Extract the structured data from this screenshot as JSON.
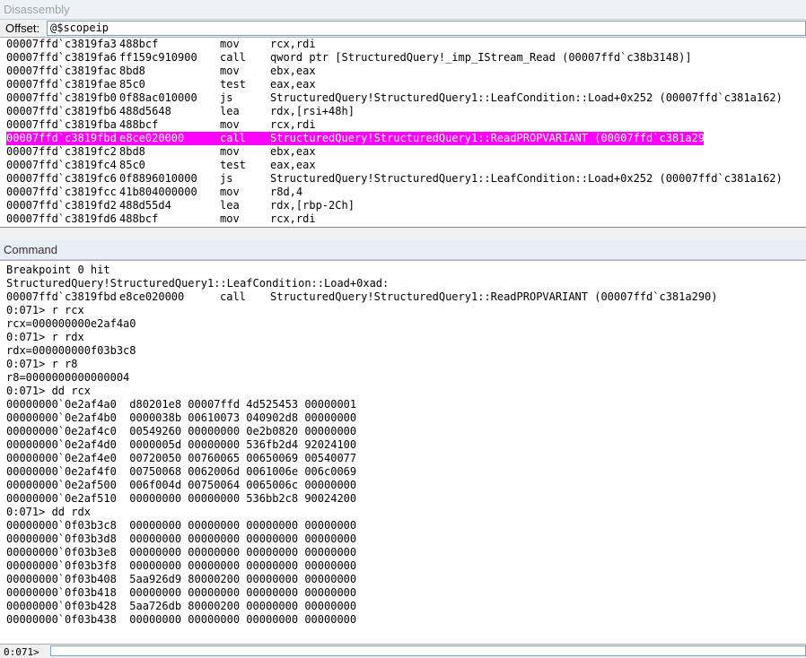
{
  "disassembly": {
    "title": "Disassembly",
    "offset_label": "Offset:",
    "offset_value": "@$scopeip",
    "rows": [
      {
        "addr": "00007ffd`c3819fa3",
        "bytes": "488bcf",
        "mnemonic": "mov",
        "operands": "rcx,rdi"
      },
      {
        "addr": "00007ffd`c3819fa6",
        "bytes": "ff159c910900",
        "mnemonic": "call",
        "operands": "qword ptr [StructuredQuery!_imp_IStream_Read (00007ffd`c38b3148)]"
      },
      {
        "addr": "00007ffd`c3819fac",
        "bytes": "8bd8",
        "mnemonic": "mov",
        "operands": "ebx,eax"
      },
      {
        "addr": "00007ffd`c3819fae",
        "bytes": "85c0",
        "mnemonic": "test",
        "operands": "eax,eax"
      },
      {
        "addr": "00007ffd`c3819fb0",
        "bytes": "0f88ac010000",
        "mnemonic": "js",
        "operands": "StructuredQuery!StructuredQuery1::LeafCondition::Load+0x252 (00007ffd`c381a162)"
      },
      {
        "addr": "00007ffd`c3819fb6",
        "bytes": "488d5648",
        "mnemonic": "lea",
        "operands": "rdx,[rsi+48h]"
      },
      {
        "addr": "00007ffd`c3819fba",
        "bytes": "488bcf",
        "mnemonic": "mov",
        "operands": "rcx,rdi"
      },
      {
        "addr": "00007ffd`c3819fbd",
        "bytes": "e8ce020000",
        "mnemonic": "call",
        "operands": "StructuredQuery!StructuredQuery1::ReadPROPVARIANT (00007ffd`c381a290)",
        "highlighted": true
      },
      {
        "addr": "00007ffd`c3819fc2",
        "bytes": "8bd8",
        "mnemonic": "mov",
        "operands": "ebx,eax"
      },
      {
        "addr": "00007ffd`c3819fc4",
        "bytes": "85c0",
        "mnemonic": "test",
        "operands": "eax,eax"
      },
      {
        "addr": "00007ffd`c3819fc6",
        "bytes": "0f8896010000",
        "mnemonic": "js",
        "operands": "StructuredQuery!StructuredQuery1::LeafCondition::Load+0x252 (00007ffd`c381a162)"
      },
      {
        "addr": "00007ffd`c3819fcc",
        "bytes": "41b804000000",
        "mnemonic": "mov",
        "operands": "r8d,4"
      },
      {
        "addr": "00007ffd`c3819fd2",
        "bytes": "488d55d4",
        "mnemonic": "lea",
        "operands": "rdx,[rbp-2Ch]"
      },
      {
        "addr": "00007ffd`c3819fd6",
        "bytes": "488bcf",
        "mnemonic": "mov",
        "operands": "rcx,rdi"
      }
    ],
    "highlight_color": "#ff00ff"
  },
  "command": {
    "title": "Command",
    "prompt_label": "0:071>",
    "lines": [
      "Breakpoint 0 hit",
      "StructuredQuery!StructuredQuery1::LeafCondition::Load+0xad:",
      {
        "addr": "00007ffd`c3819fbd",
        "bytes": "e8ce020000",
        "mnemonic": "call",
        "operands": "StructuredQuery!StructuredQuery1::ReadPROPVARIANT (00007ffd`c381a290)"
      },
      "0:071> r rcx",
      "rcx=000000000e2af4a0",
      "0:071> r rdx",
      "rdx=000000000f03b3c8",
      "0:071> r r8",
      "r8=0000000000000004",
      "0:071> dd rcx",
      "00000000`0e2af4a0  d80201e8 00007ffd 4d525453 00000001",
      "00000000`0e2af4b0  0000038b 00610073 040902d8 00000000",
      "00000000`0e2af4c0  00549260 00000000 0e2b0820 00000000",
      "00000000`0e2af4d0  0000005d 00000000 536fb2d4 92024100",
      "00000000`0e2af4e0  00720050 00760065 00650069 00540077",
      "00000000`0e2af4f0  00750068 0062006d 0061006e 006c0069",
      "00000000`0e2af500  006f004d 00750064 0065006c 00000000",
      "00000000`0e2af510  00000000 00000000 536bb2c8 90024200",
      "0:071> dd rdx",
      "00000000`0f03b3c8  00000000 00000000 00000000 00000000",
      "00000000`0f03b3d8  00000000 00000000 00000000 00000000",
      "00000000`0f03b3e8  00000000 00000000 00000000 00000000",
      "00000000`0f03b3f8  00000000 00000000 00000000 00000000",
      "00000000`0f03b408  5aa926d9 80000200 00000000 00000000",
      "00000000`0f03b418  00000000 00000000 00000000 00000000",
      "00000000`0f03b428  5aa726db 80000200 00000000 00000000",
      "00000000`0f03b438  00000000 00000000 00000000 00000000"
    ]
  }
}
